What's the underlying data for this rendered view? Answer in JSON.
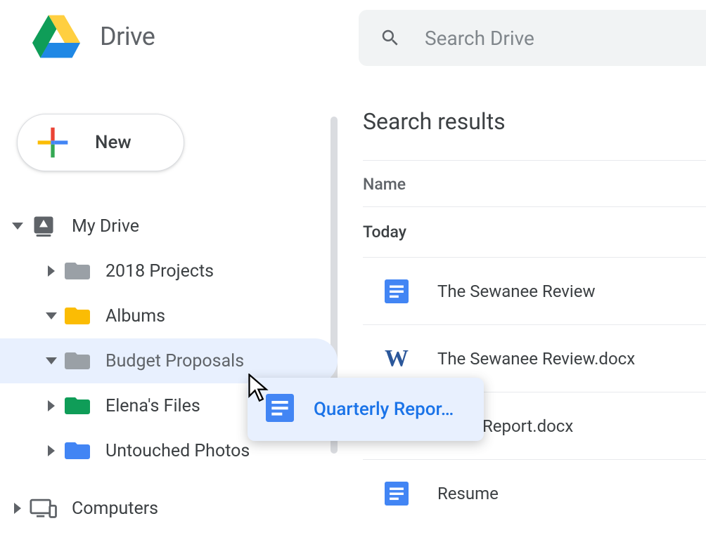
{
  "header": {
    "app_title": "Drive",
    "search_placeholder": "Search Drive"
  },
  "sidebar": {
    "new_label": "New",
    "root": {
      "label": "My Drive",
      "expanded": true
    },
    "items": [
      {
        "label": "2018 Projects",
        "color": "gray",
        "expanded": false
      },
      {
        "label": "Albums",
        "color": "yellow",
        "expanded": true
      },
      {
        "label": "Budget Proposals",
        "color": "gray",
        "expanded": true,
        "selected": true
      },
      {
        "label": "Elena's Files",
        "color": "green",
        "expanded": false
      },
      {
        "label": "Untouched Photos",
        "color": "blue",
        "expanded": false
      }
    ],
    "computers_label": "Computers"
  },
  "main": {
    "title": "Search results",
    "column_header": "Name",
    "section_label": "Today",
    "files": [
      {
        "name": "The Sewanee Review",
        "type": "gdoc"
      },
      {
        "name": "The Sewanee Review.docx",
        "type": "word"
      },
      {
        "name": "Report.docx",
        "type": "word_partial"
      },
      {
        "name": "Resume",
        "type": "gdoc"
      }
    ]
  },
  "drag": {
    "label": "Quarterly Repor…"
  }
}
